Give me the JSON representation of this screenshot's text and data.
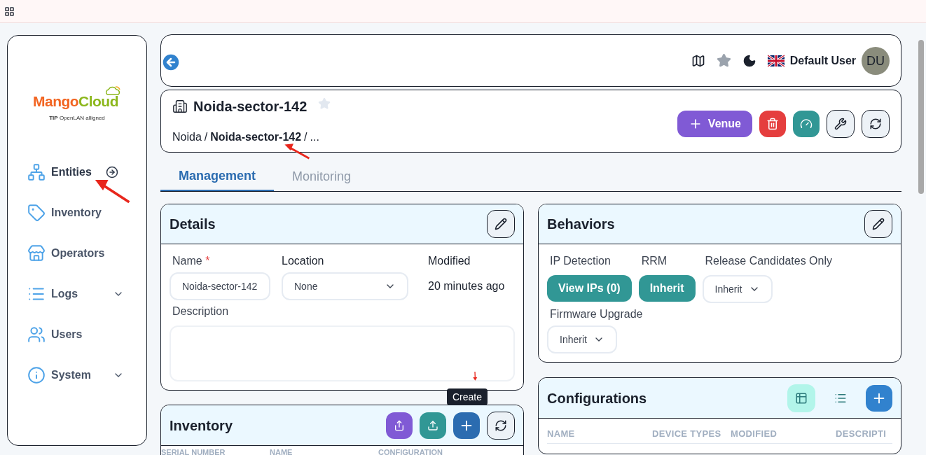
{
  "logo": {
    "brand_first": "Mango",
    "brand_second": "Cloud",
    "tagline_bold": "TIP",
    "tagline": "OpenLAN alligned"
  },
  "sidebar": {
    "items": [
      {
        "label": "Entities",
        "selected": true,
        "expandable": false
      },
      {
        "label": "Inventory",
        "selected": false,
        "expandable": false
      },
      {
        "label": "Operators",
        "selected": false,
        "expandable": false
      },
      {
        "label": "Logs",
        "selected": false,
        "expandable": true
      },
      {
        "label": "Users",
        "selected": false,
        "expandable": false
      },
      {
        "label": "System",
        "selected": false,
        "expandable": true
      }
    ]
  },
  "header": {
    "user_name": "Default User",
    "avatar_initials": "DU"
  },
  "entity": {
    "title": "Noida-sector-142",
    "breadcrumb": [
      "Noida",
      "Noida-sector-142",
      "..."
    ],
    "breadcrumb_separator": "/",
    "add_button": "Venue"
  },
  "tabs": [
    {
      "label": "Management",
      "selected": true
    },
    {
      "label": "Monitoring",
      "selected": false
    }
  ],
  "details": {
    "title": "Details",
    "name_label": "Name",
    "required_mark": "*",
    "name_value": "Noida-sector-142",
    "location_label": "Location",
    "location_value": "None",
    "modified_label": "Modified",
    "modified_value": "20 minutes ago",
    "description_label": "Description"
  },
  "inventory": {
    "title": "Inventory",
    "tooltip": "Create",
    "columns": [
      "SERIAL NUMBER",
      "NAME",
      "CONFIGURATION"
    ]
  },
  "behaviors": {
    "title": "Behaviors",
    "ip_label": "IP Detection",
    "ip_button": "View IPs (0)",
    "rrm_label": "RRM",
    "rrm_button": "Inherit",
    "rc_label": "Release Candidates Only",
    "rc_value": "Inherit",
    "fw_label": "Firmware Upgrade",
    "fw_value": "Inherit"
  },
  "configurations": {
    "title": "Configurations",
    "view_buttons": [
      {
        "selected": true
      },
      {
        "selected": false
      }
    ],
    "columns": [
      "NAME",
      "DEVICE TYPES",
      "MODIFIED",
      "DESCRIPTI"
    ]
  }
}
